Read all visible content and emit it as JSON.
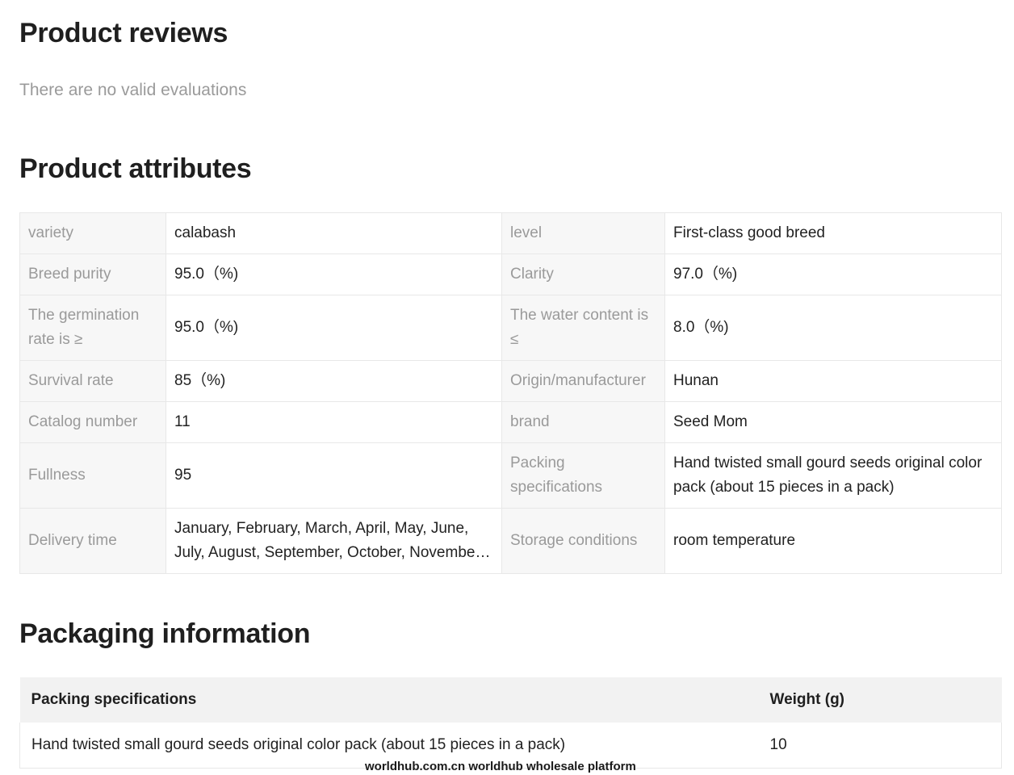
{
  "reviews": {
    "title": "Product reviews",
    "empty_message": "There are no valid evaluations"
  },
  "attributes": {
    "title": "Product attributes",
    "rows": [
      [
        {
          "k": "variety",
          "v": "calabash"
        },
        {
          "k": "level",
          "v": "First-class good breed"
        }
      ],
      [
        {
          "k": "Breed purity",
          "v": "95.0（%)"
        },
        {
          "k": "Clarity",
          "v": "97.0（%)"
        }
      ],
      [
        {
          "k": "The germination rate is ≥",
          "v": "95.0（%)"
        },
        {
          "k": "The water content is ≤",
          "v": "8.0（%)"
        }
      ],
      [
        {
          "k": "Survival rate",
          "v": "85（%)"
        },
        {
          "k": "Origin/manufacturer",
          "v": "Hunan"
        }
      ],
      [
        {
          "k": "Catalog number",
          "v": "11"
        },
        {
          "k": "brand",
          "v": "Seed Mom"
        }
      ],
      [
        {
          "k": "Fullness",
          "v": "95"
        },
        {
          "k": "Packing specifications",
          "v": "Hand twisted small gourd seeds original color pack (about 15 pieces in a pack)"
        }
      ],
      [
        {
          "k": "Delivery time",
          "v": "January, February, March, April, May, June, July, August, September, October, November, December"
        },
        {
          "k": "Storage conditions",
          "v": "room temperature"
        }
      ]
    ]
  },
  "packaging": {
    "title": "Packaging information",
    "columns": [
      "Packing specifications",
      "Weight (g)"
    ],
    "rows": [
      [
        "Hand twisted small gourd seeds original color pack (about 15 pieces in a pack)",
        "10"
      ]
    ]
  },
  "watermark": "worldhub.com.cn worldhub wholesale platform"
}
